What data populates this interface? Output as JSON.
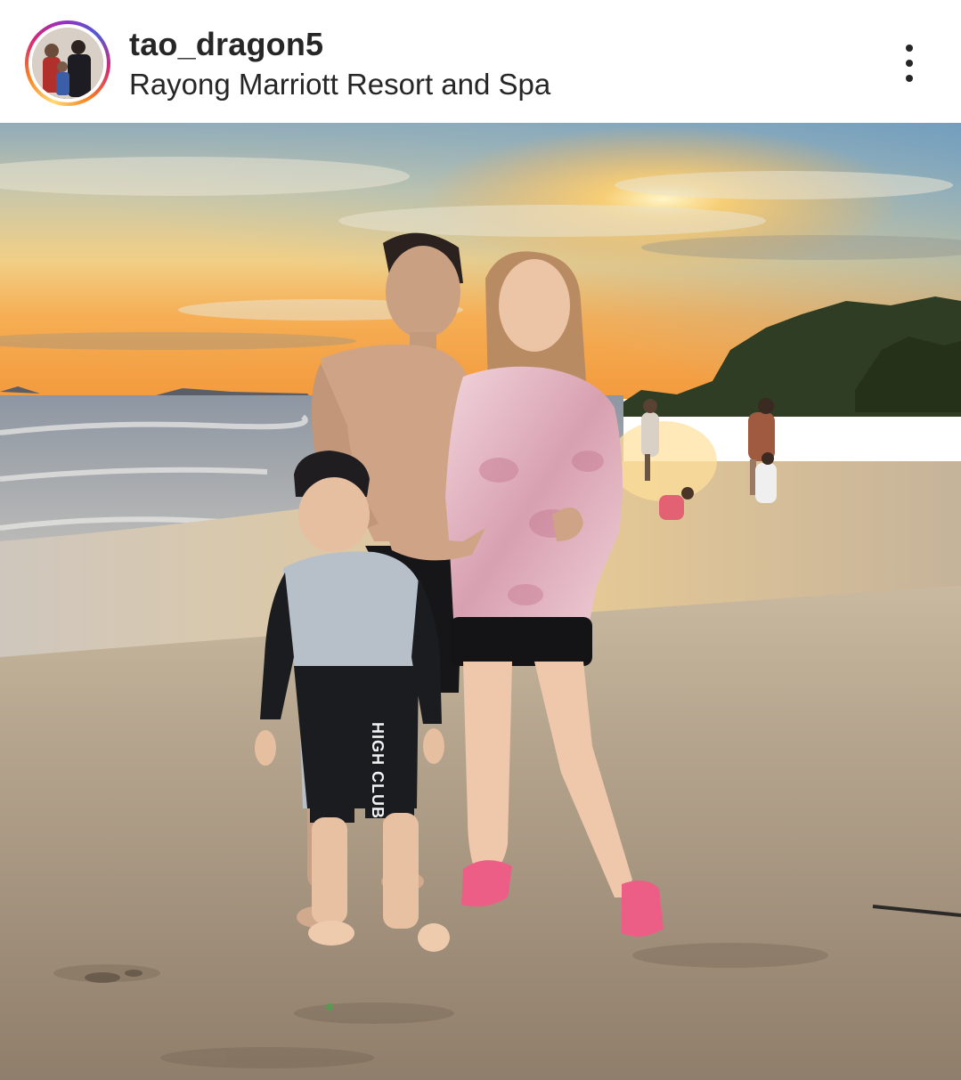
{
  "post": {
    "username": "tao_dragon5",
    "location": "Rayong Marriott Resort and Spa",
    "avatar_icon": "profile-avatar",
    "more_icon": "more-vertical-icon",
    "photo": {
      "shirt_print": "HIGH CLUB"
    }
  },
  "colors": {
    "text": "#262626",
    "ring_gradient": [
      "#feda75",
      "#fa7e1e",
      "#d62976",
      "#962fbf",
      "#4f5bd5"
    ]
  }
}
